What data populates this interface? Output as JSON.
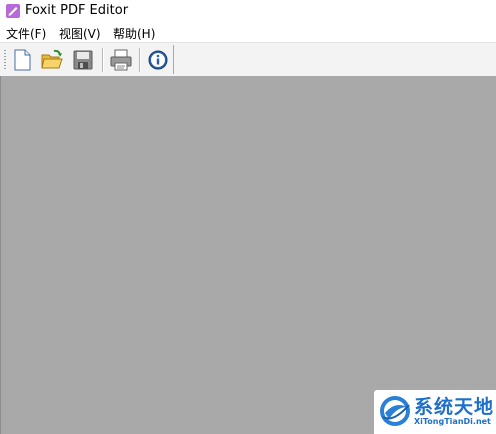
{
  "window": {
    "title": "Foxit PDF Editor"
  },
  "menu": {
    "items": [
      {
        "label": "文件(F)"
      },
      {
        "label": "视图(V)"
      },
      {
        "label": "帮助(H)"
      }
    ]
  },
  "toolbar": {
    "buttons": [
      "new-document",
      "open-folder",
      "save",
      "print",
      "about-info"
    ]
  },
  "colors": {
    "workspace": "#a9a9a9",
    "toolbar": "#f3f3f3",
    "watermark_blue": "#1e6fc9"
  },
  "watermark": {
    "brand_cn": "系统天地",
    "brand_en": "XiTongTianDi.net"
  }
}
